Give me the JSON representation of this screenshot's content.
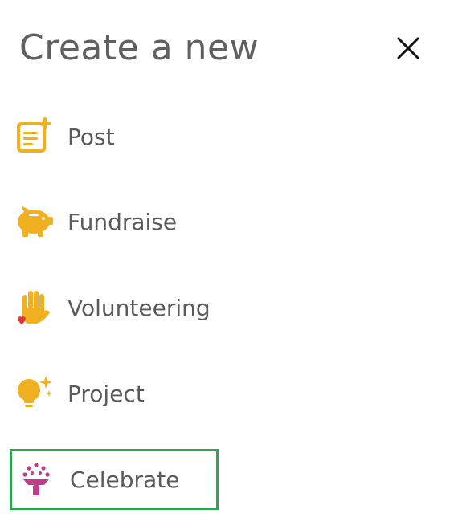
{
  "header": {
    "title": "Create a new"
  },
  "menu": {
    "items": [
      {
        "label": "Post",
        "icon": "document-plus-icon"
      },
      {
        "label": "Fundraise",
        "icon": "piggy-bank-icon"
      },
      {
        "label": "Volunteering",
        "icon": "raised-hand-heart-icon"
      },
      {
        "label": "Project",
        "icon": "lightbulb-sparkle-icon"
      },
      {
        "label": "Celebrate",
        "icon": "party-popper-icon",
        "highlighted": true
      }
    ]
  },
  "colors": {
    "accent_yellow": "#F0B020",
    "celebrate_purple": "#C03C8C",
    "highlight_green": "#2EA44F",
    "text": "#5A5A5A"
  }
}
